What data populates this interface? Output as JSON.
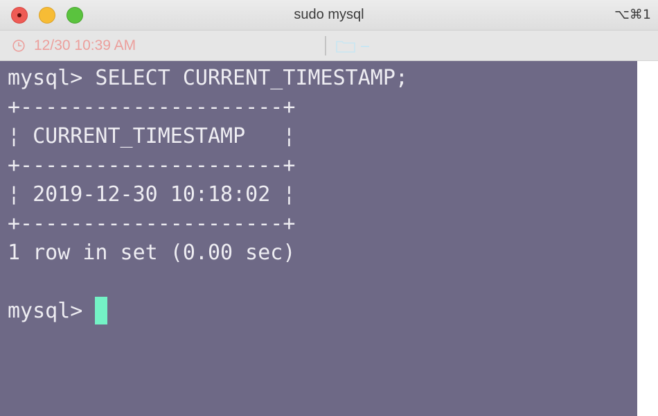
{
  "window": {
    "title": "sudo mysql",
    "shortcut": "⌥⌘1",
    "controls": {
      "close": "close-window",
      "minimize": "minimize-window",
      "zoom": "zoom-window"
    }
  },
  "statusbar": {
    "time": "12/30 10:39 AM",
    "time_icon": "clock-icon",
    "directory_icon": "folder-icon"
  },
  "terminal": {
    "lines": [
      "mysql> SELECT CURRENT_TIMESTAMP;",
      "+---------------------+",
      "¦ CURRENT_TIMESTAMP   ¦",
      "+---------------------+",
      "¦ 2019-12-30 10:18:02 ¦",
      "+---------------------+",
      "1 row in set (0.00 sec)",
      ""
    ],
    "prompt": "mysql> "
  },
  "colors": {
    "terminal_bg": "#6e6986",
    "terminal_fg": "#eeedf2",
    "cursor": "#74f2c6",
    "status_time": "#ec9f9c",
    "close": "#ee5b55",
    "minimize": "#f7bc35",
    "zoom": "#5ac33e"
  }
}
